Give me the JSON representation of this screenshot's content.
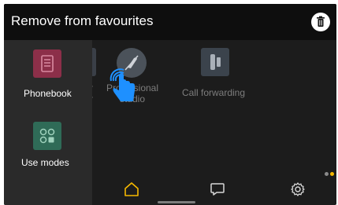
{
  "header": {
    "title": "Remove from favourites",
    "delete_icon": "trash-icon"
  },
  "favourites": [
    {
      "label": "Phonebook",
      "icon": "phonebook-icon",
      "color": "#8c2f49"
    },
    {
      "label": "Use modes",
      "icon": "use-modes-icon",
      "color": "#2f6b57"
    }
  ],
  "main_items": [
    {
      "label": "Professional studio",
      "label_fragments": [
        "r",
        "r"
      ],
      "icon": "professional-studio-icon"
    },
    {
      "label": "Call forwarding",
      "icon": "call-forwarding-icon"
    }
  ],
  "gesture": {
    "icon": "tap-hand-icon"
  },
  "nav": {
    "items": [
      "home-icon",
      "chat-icon",
      "settings-icon"
    ],
    "active": "home-icon",
    "accent": "#f5b800"
  },
  "page_indicator": {
    "pages": 2,
    "active": 1
  }
}
